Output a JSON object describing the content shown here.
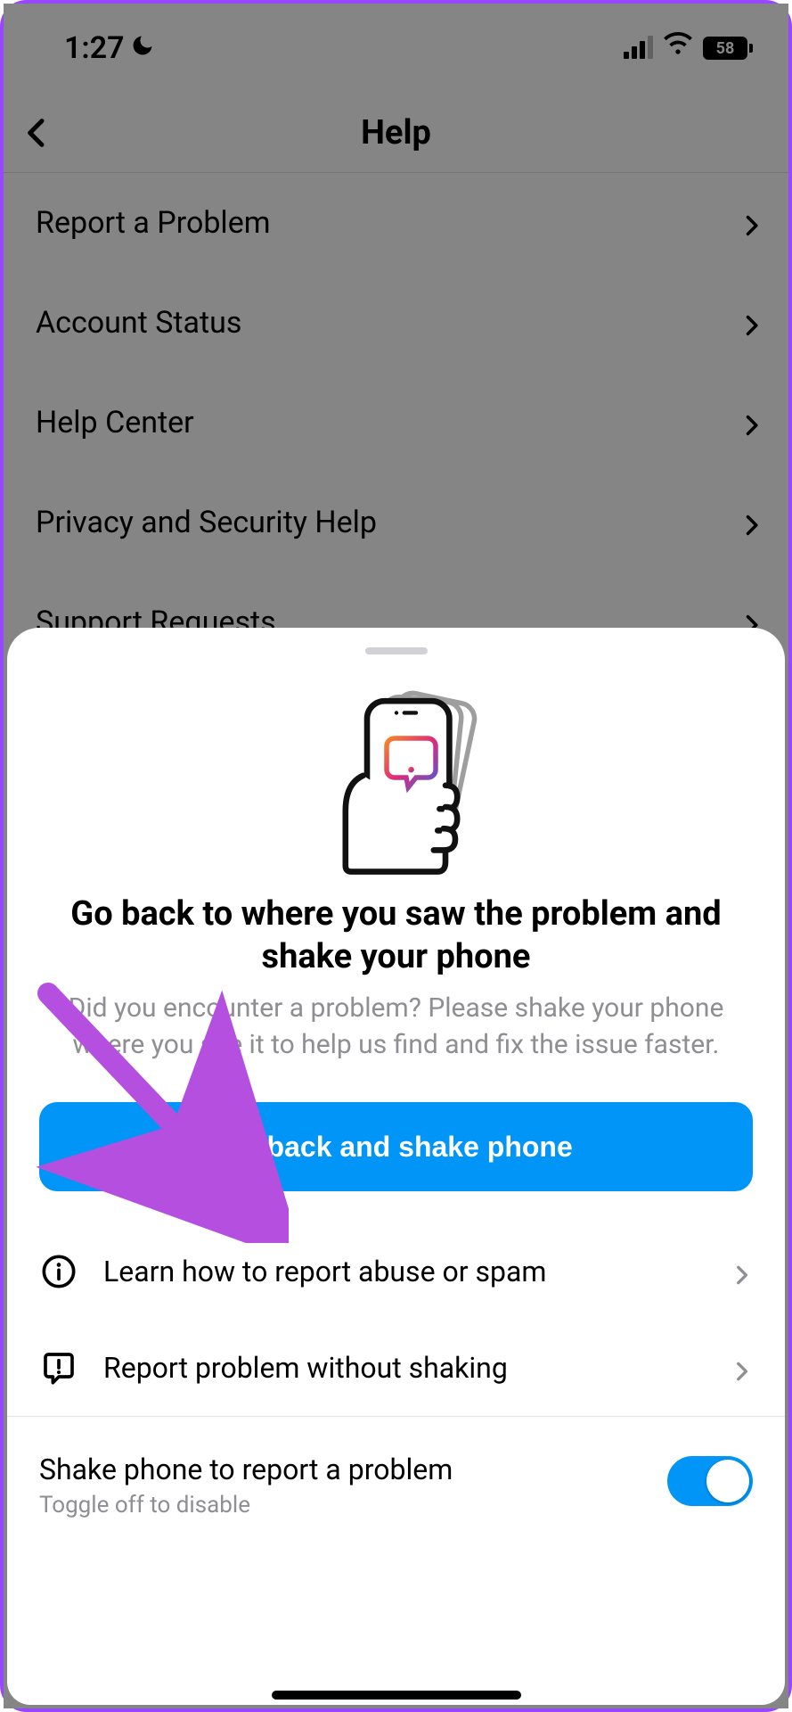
{
  "status_bar": {
    "time": "1:27",
    "battery_percent": "58"
  },
  "nav": {
    "title": "Help"
  },
  "help_items": [
    {
      "label": "Report a Problem"
    },
    {
      "label": "Account Status"
    },
    {
      "label": "Help Center"
    },
    {
      "label": "Privacy and Security Help"
    },
    {
      "label": "Support Requests"
    }
  ],
  "sheet": {
    "title": "Go back to where you saw the problem and shake your phone",
    "description": "Did you encounter a problem? Please shake your phone where you see it to help us find and fix the issue faster.",
    "primary_button": "Go back and shake phone",
    "rows": [
      {
        "label": "Learn how to report abuse or spam"
      },
      {
        "label": "Report problem without shaking"
      }
    ],
    "toggle": {
      "title": "Shake phone to report a problem",
      "subtitle": "Toggle off to disable",
      "on": true
    }
  }
}
